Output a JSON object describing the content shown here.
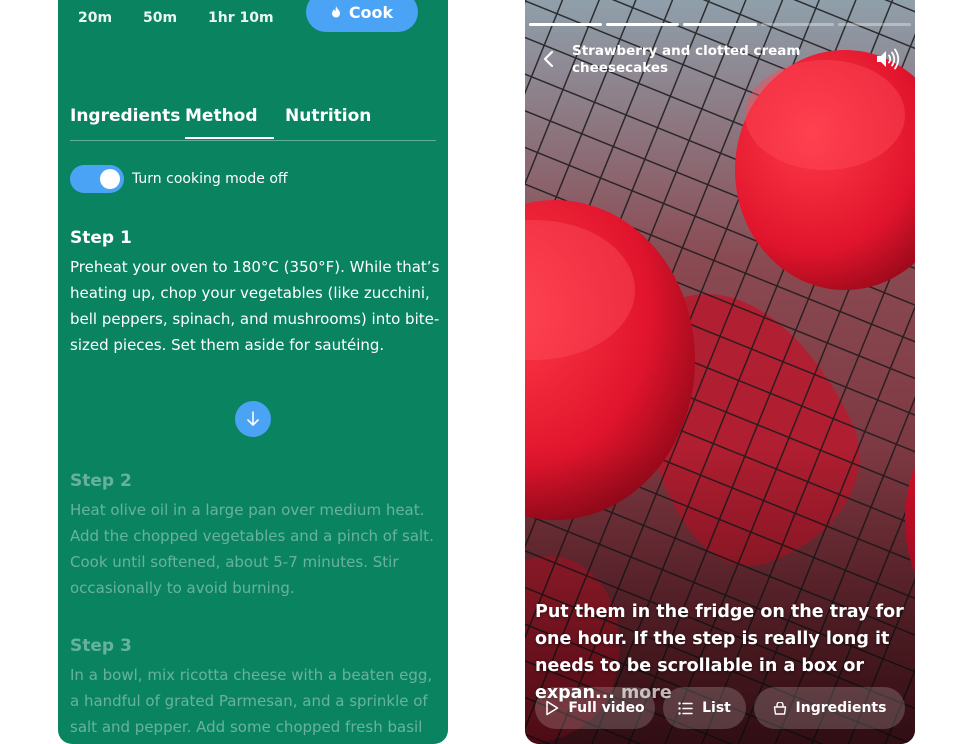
{
  "recipe": {
    "times": [
      "20m",
      "50m",
      "1hr 10m"
    ],
    "cook_label": "Cook",
    "tabs": [
      "Ingredients",
      "Method",
      "Nutrition"
    ],
    "active_tab": "Method",
    "cooking_mode_label": "Turn cooking mode off",
    "cooking_mode_on": true,
    "steps": [
      {
        "title": "Step 1",
        "text": "Preheat your oven to 180°C (350°F). While that’s heating up, chop your vegetables (like zucchini, bell peppers, spinach, and mushrooms) into bite-sized pieces. Set them aside for sautéing."
      },
      {
        "title": "Step 2",
        "text": "Heat olive oil in a large pan over medium heat. Add the chopped vegetables and a pinch of salt. Cook until softened, about 5-7 minutes. Stir occasionally to avoid burning."
      },
      {
        "title": "Step 3",
        "text": "In a bowl, mix ricotta cheese with a beaten egg, a handful of grated Parmesan, and a sprinkle of salt and pepper. Add some chopped fresh basil"
      }
    ]
  },
  "video": {
    "title": "Strawberry and clotted cream cheesecakes",
    "progress": {
      "segments_total": 5,
      "segments_done": 3
    },
    "caption": "Put them in the fridge on the tray for one hour. If the step is really long it needs to be scrollable in a box or expan...",
    "more_label": " more",
    "buttons": {
      "full_video": "Full video",
      "list": "List",
      "ingredients": "Ingredients"
    }
  },
  "colors": {
    "panel_green": "#0a8361",
    "accent_blue": "#4aa3f5",
    "glaze_red": "#e0142c"
  },
  "icons": [
    "flame-icon",
    "arrow-down-icon",
    "chevron-left-icon",
    "speaker-icon",
    "play-icon",
    "list-icon",
    "basket-icon"
  ]
}
